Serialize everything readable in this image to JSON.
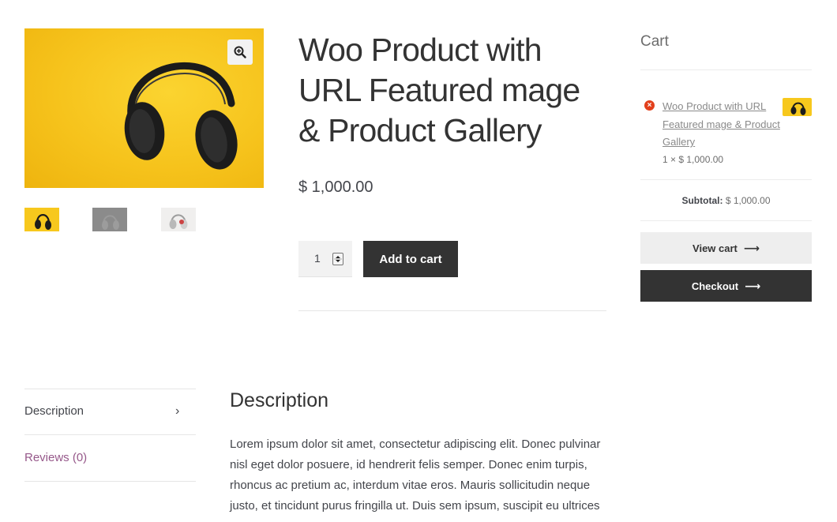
{
  "gallery": {
    "zoom_icon": "zoom-in-icon",
    "main_image_alt": "headphones on yellow background",
    "thumbnails": [
      "headphones-yellow",
      "headphones-gray",
      "headphones-white"
    ]
  },
  "product": {
    "title": "Woo Product with URL Featured mage & Product Gallery",
    "price": "$ 1,000.00",
    "quantity": "1",
    "add_to_cart_label": "Add to cart"
  },
  "cart": {
    "title": "Cart",
    "item_name": "Woo Product with URL Featured mage & Product Gallery",
    "item_qty": "1 × $ 1,000.00",
    "subtotal_label": "Subtotal:",
    "subtotal_value": "$ 1,000.00",
    "view_cart_label": "View cart",
    "checkout_label": "Checkout",
    "arrow": "⟶"
  },
  "tabs": {
    "description_label": "Description",
    "reviews_label": "Reviews (0)",
    "chevron": "›"
  },
  "description": {
    "heading": "Description",
    "body": "Lorem ipsum dolor sit amet, consectetur adipiscing elit. Donec pulvinar nisl eget dolor posuere, id hendrerit felis semper. Donec enim turpis, rhoncus ac pretium ac, interdum vitae eros. Mauris sollicitudin neque justo, et tincidunt purus fringilla ut. Duis sem ipsum, suscipit eu ultrices"
  },
  "colors": {
    "accent_purple": "#96588a",
    "dark_button": "#333333",
    "light_button": "#eeeeee",
    "remove_red": "#e2401c",
    "image_yellow": "#f6c31c"
  }
}
